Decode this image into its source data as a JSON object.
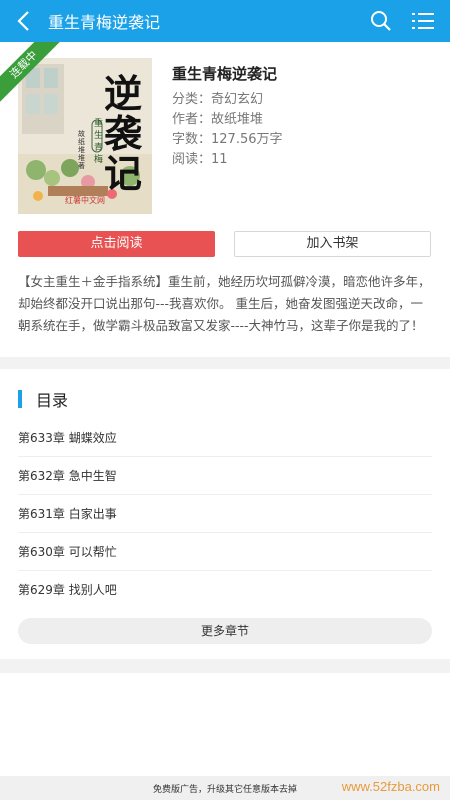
{
  "header": {
    "title": "重生青梅逆袭记",
    "back_icon": "back-arrow-icon",
    "search_icon": "search-icon",
    "menu_icon": "list-menu-icon",
    "color": "#1aa1e8"
  },
  "book": {
    "status_ribbon": "连载中",
    "cover": {
      "title": "逆袭记",
      "subtitle": "重生青梅",
      "author_small": "故纸堆堆著",
      "publisher": "红薯中文网"
    },
    "name": "重生青梅逆袭记",
    "category": "分类：奇幻玄幻",
    "author": "作者：故纸堆堆",
    "word_count": "字数：127.56万字",
    "reads": "阅读：11"
  },
  "actions": {
    "read": "点击阅读",
    "add_shelf": "加入书架"
  },
  "description": "【女主重生＋金手指系统】重生前，她经历坎坷孤僻冷漠，暗恋他许多年，却始终都没开口说出那句---我喜欢你。 重生后，她奋发图强逆天改命，一朝系统在手，做学霸斗极品致富又发家----大神竹马，这辈子你是我的了！",
  "catalog": {
    "title": "目录",
    "chapters": [
      "第633章 蝴蝶效应",
      "第632章 急中生智",
      "第631章 白家出事",
      "第630章 可以帮忙",
      "第629章 找别人吧"
    ],
    "more": "更多章节"
  },
  "ad": {
    "text": "免费版广告，升级其它任意版本去掉",
    "watermark": "www.52fzba.com"
  }
}
